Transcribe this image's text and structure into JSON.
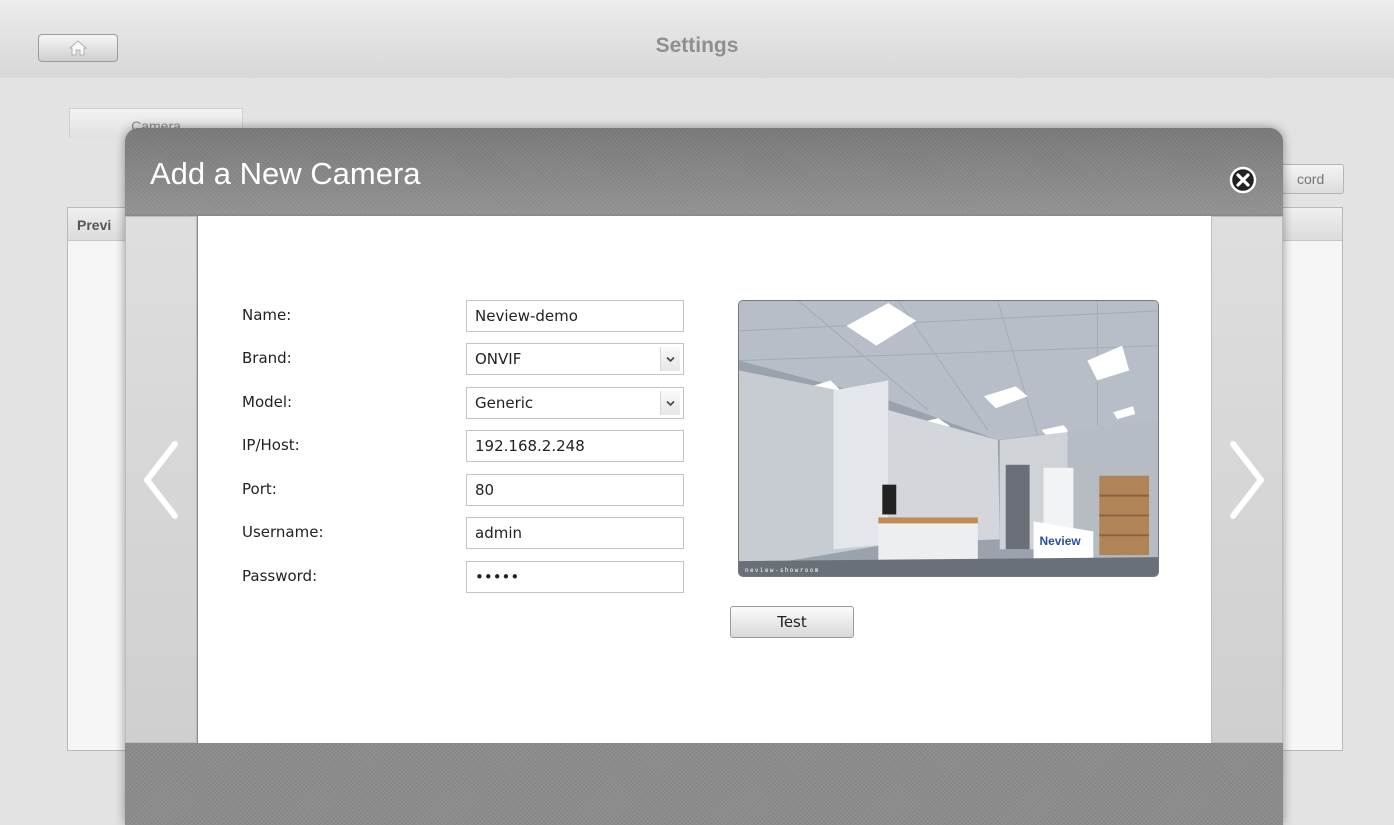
{
  "app": {
    "title": "Settings",
    "home_icon": "home-icon",
    "tab_camera": "Camera",
    "record_button": "cord",
    "panel_header": "Previ"
  },
  "dialog": {
    "title": "Add a New Camera",
    "close_icon": "close-circle-icon",
    "prev_icon": "chevron-left-icon",
    "next_icon": "chevron-right-icon",
    "form": {
      "name": {
        "label": "Name:",
        "value": "Neview-demo"
      },
      "brand": {
        "label": "Brand:",
        "value": "ONVIF"
      },
      "model": {
        "label": "Model:",
        "value": "Generic"
      },
      "host": {
        "label": "IP/Host:",
        "value": "192.168.2.248"
      },
      "port": {
        "label": "Port:",
        "value": "80"
      },
      "username": {
        "label": "Username:",
        "value": "admin"
      },
      "password": {
        "label": "Password:",
        "value": "admin"
      }
    },
    "preview": {
      "brand_sign": "Neview",
      "watermark": "neview-showroom"
    },
    "test_button": "Test"
  },
  "colors": {
    "dialog_chrome": "#8c8c8c",
    "content_bg": "#ffffff",
    "background": "#e3e3e3"
  }
}
